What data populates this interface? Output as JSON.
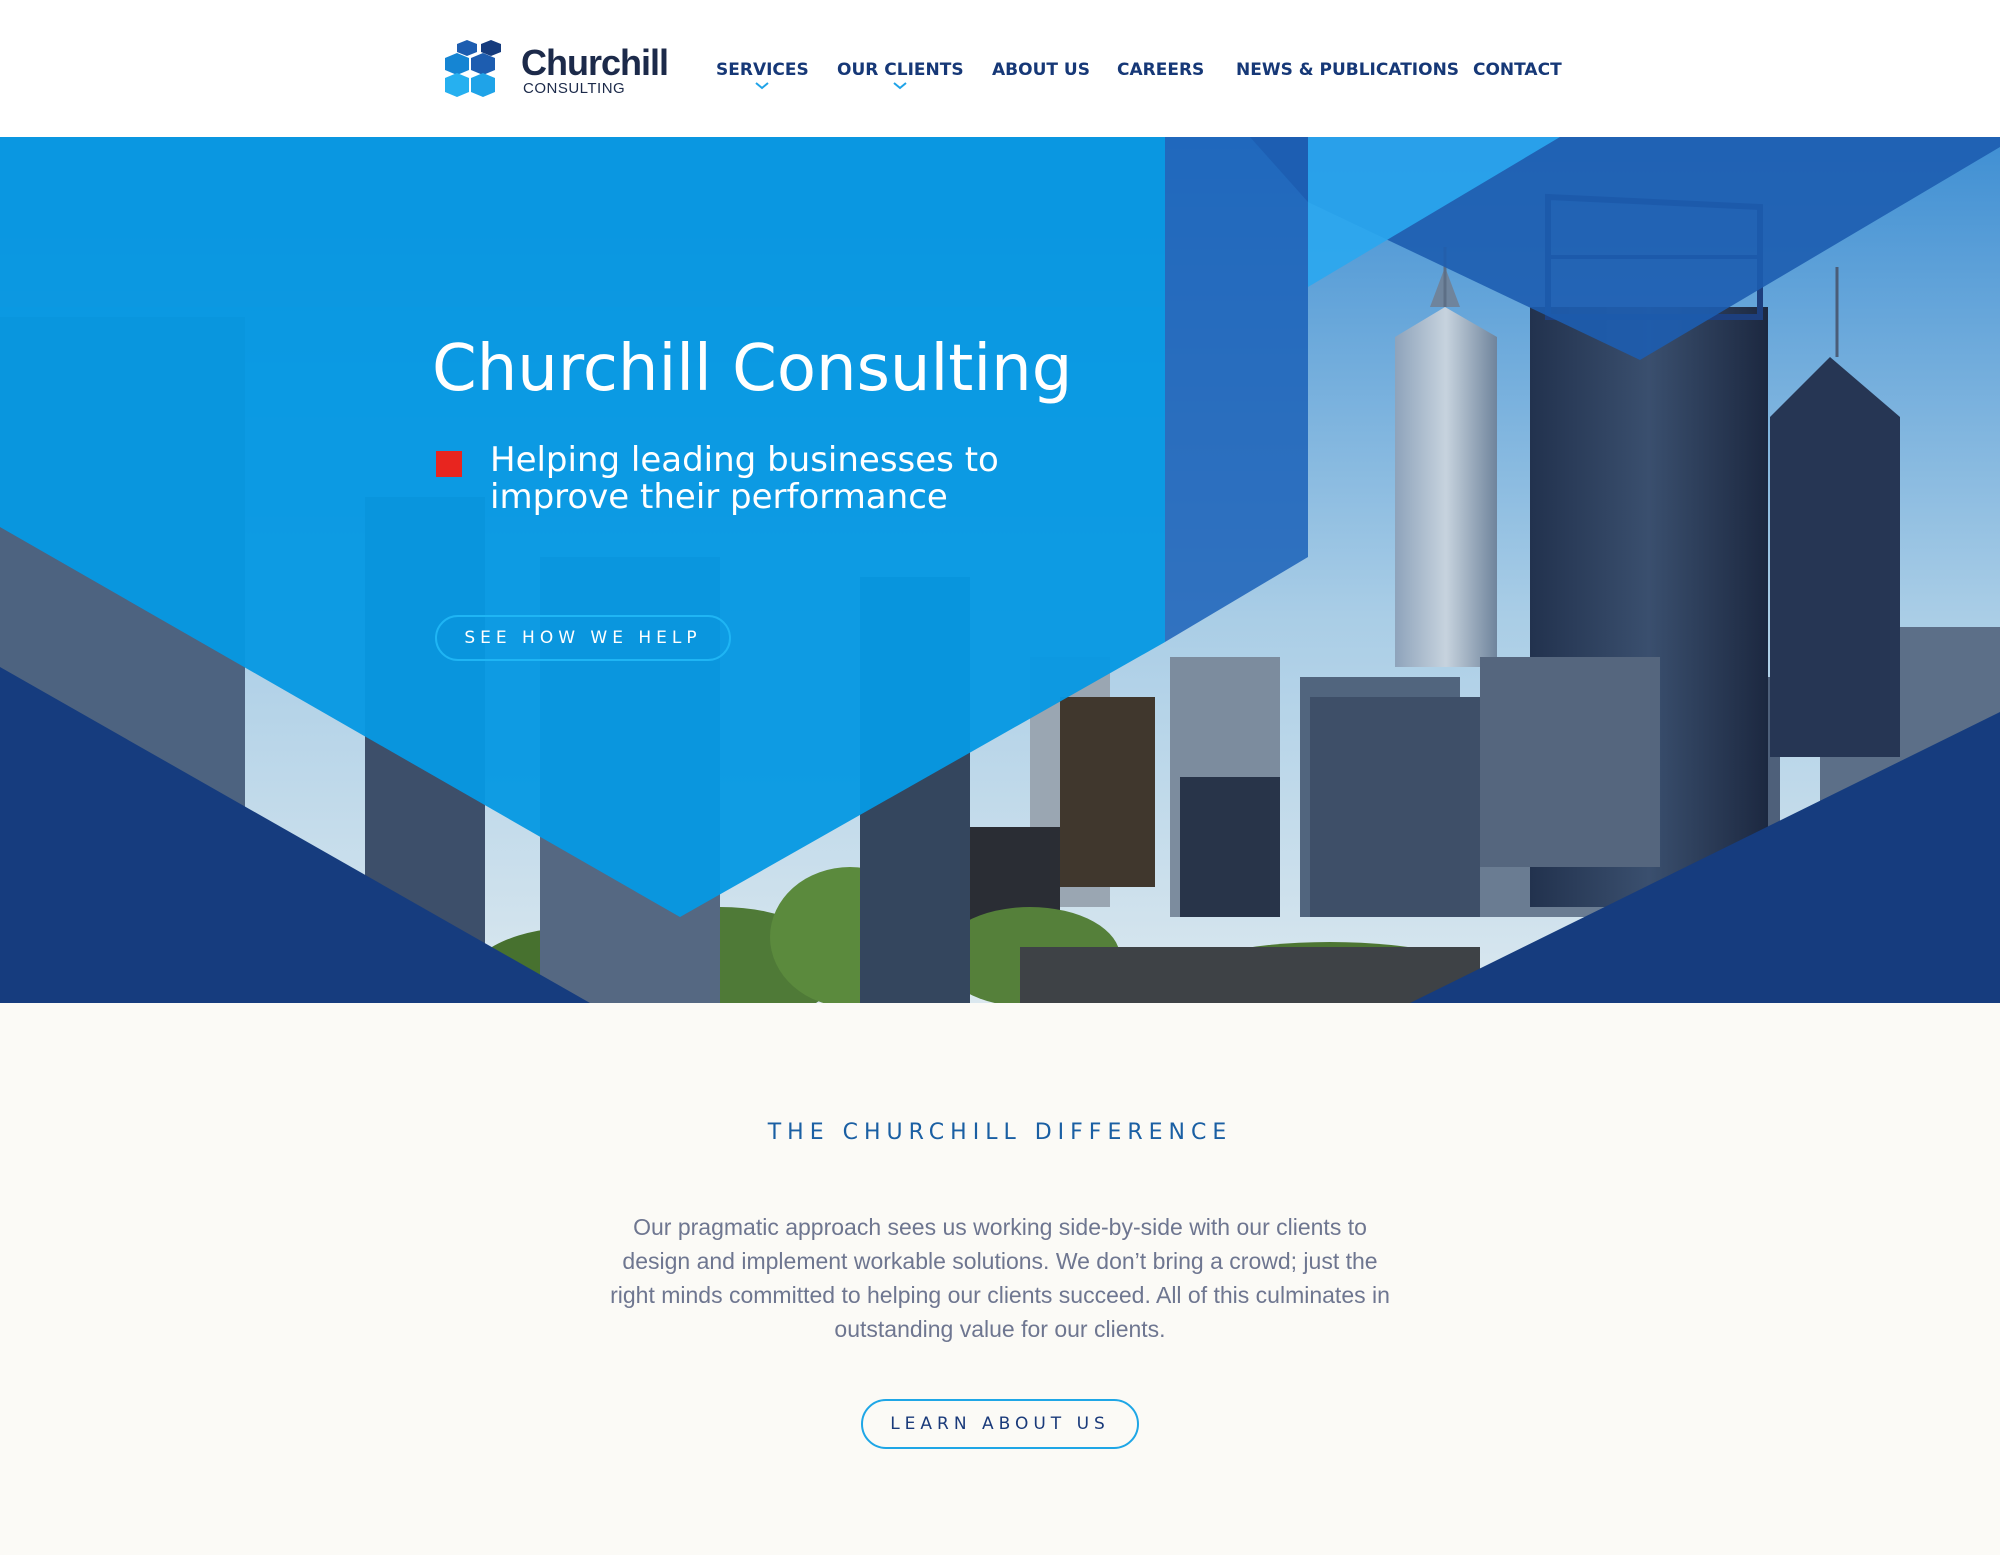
{
  "brand": {
    "name": "Churchill",
    "sub": "CONSULTING"
  },
  "nav": {
    "items": [
      {
        "label": "SERVICES",
        "has_dropdown": true
      },
      {
        "label": "OUR CLIENTS",
        "has_dropdown": true
      },
      {
        "label": "ABOUT US",
        "has_dropdown": false
      },
      {
        "label": "CAREERS",
        "has_dropdown": false
      },
      {
        "label": "NEWS & PUBLICATIONS",
        "has_dropdown": false
      },
      {
        "label": "CONTACT",
        "has_dropdown": false
      }
    ]
  },
  "hero": {
    "title": "Churchill Consulting",
    "subtitle": "Helping leading businesses to improve their performance",
    "button": "SEE HOW WE HELP"
  },
  "difference": {
    "heading": "THE CHURCHILL DIFFERENCE",
    "body": "Our pragmatic approach sees us working side-by-side with our clients to design and implement workable solutions. We don’t bring a crowd; just the right minds committed to helping our clients succeed. All of this culminates in outstanding value for our clients.",
    "button": "LEARN ABOUT US"
  },
  "colors": {
    "nav_text": "#163877",
    "hero_blue": "#0799e3",
    "navy": "#163c7e",
    "accent_red": "#e8251f",
    "button_border": "#1fb5f4",
    "heading_blue": "#1a5fa3",
    "body_gray": "#6e7690",
    "section_bg": "#fbfaf6"
  }
}
